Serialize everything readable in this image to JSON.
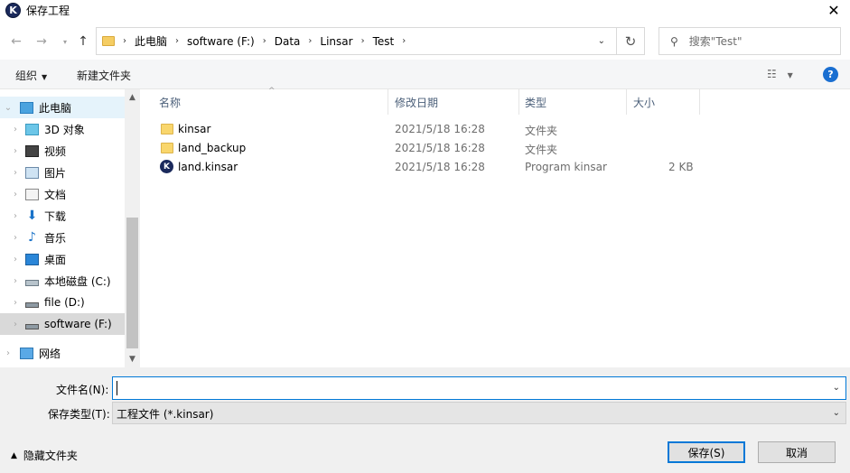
{
  "window": {
    "title": "保存工程"
  },
  "address": {
    "crumbs": [
      "此电脑",
      "software (F:)",
      "Data",
      "Linsar",
      "Test"
    ]
  },
  "search": {
    "placeholder": "搜索\"Test\""
  },
  "toolbar": {
    "organize": "组织",
    "new_folder": "新建文件夹"
  },
  "nav": {
    "items": [
      {
        "label": "此电脑",
        "icon": "computer-icon"
      },
      {
        "label": "3D 对象",
        "icon": "3d-objects-icon"
      },
      {
        "label": "视频",
        "icon": "video-icon"
      },
      {
        "label": "图片",
        "icon": "pictures-icon"
      },
      {
        "label": "文档",
        "icon": "documents-icon"
      },
      {
        "label": "下载",
        "icon": "download-icon"
      },
      {
        "label": "音乐",
        "icon": "music-icon"
      },
      {
        "label": "桌面",
        "icon": "desktop-icon"
      },
      {
        "label": "本地磁盘 (C:)",
        "icon": "drive-icon"
      },
      {
        "label": "file (D:)",
        "icon": "drive-icon"
      },
      {
        "label": "software (F:)",
        "icon": "drive-icon"
      },
      {
        "label": "网络",
        "icon": "network-icon"
      }
    ]
  },
  "columns": {
    "name": "名称",
    "date": "修改日期",
    "type": "类型",
    "size": "大小"
  },
  "files": [
    {
      "name": "kinsar",
      "date": "2021/5/18 16:28",
      "type": "文件夹",
      "size": "",
      "icon": "folder-icon"
    },
    {
      "name": "land_backup",
      "date": "2021/5/18 16:28",
      "type": "文件夹",
      "size": "",
      "icon": "folder-icon"
    },
    {
      "name": "land.kinsar",
      "date": "2021/5/18 16:28",
      "type": "Program kinsar",
      "size": "2 KB",
      "icon": "kinsar-file-icon"
    }
  ],
  "form": {
    "filename_label": "文件名(N):",
    "filename_value": "",
    "filetype_label": "保存类型(T):",
    "filetype_value": "工程文件 (*.kinsar)"
  },
  "footer": {
    "hide_folders": "隐藏文件夹",
    "save": "保存(S)",
    "cancel": "取消"
  }
}
